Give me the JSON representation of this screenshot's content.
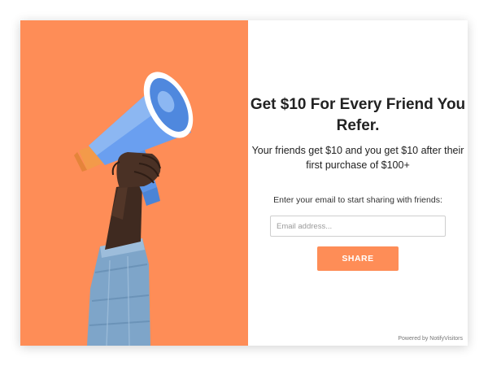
{
  "popup": {
    "headline": "Get $10 For Every Friend You Refer.",
    "subtext": "Your friends get $10 and you get $10 after their first purchase of $100+",
    "email_prompt": "Enter your email to start sharing with friends:",
    "email_input": {
      "value": "",
      "placeholder": "Email address..."
    },
    "share_button_label": "SHARE",
    "powered_by": "Powered by NotifyVisitors"
  },
  "image": {
    "icon": "megaphone-icon",
    "description_tag": "hand-holding-megaphone-illustration"
  },
  "colors": {
    "accent": "#fe8d57",
    "megaphone_blue": "#5b95e8",
    "megaphone_light_blue": "#8cb7f2",
    "text": "#222222"
  }
}
